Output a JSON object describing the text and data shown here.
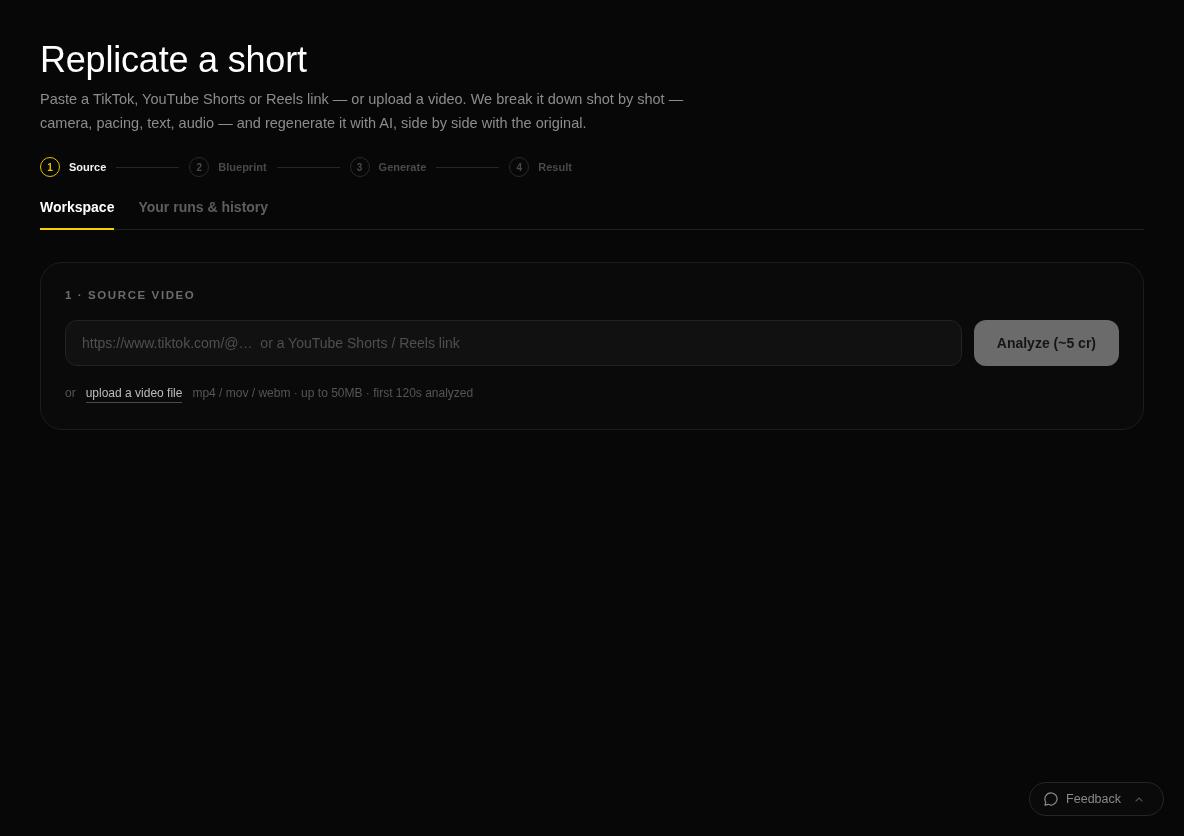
{
  "header": {
    "title": "Replicate a short",
    "subtitle": "Paste a TikTok, YouTube Shorts or Reels link — or upload a video. We break it down shot by shot — camera, pacing, text, audio — and regenerate it with AI, side by side with the original."
  },
  "steps": [
    {
      "number": "1",
      "label": "Source",
      "active": true
    },
    {
      "number": "2",
      "label": "Blueprint",
      "active": false
    },
    {
      "number": "3",
      "label": "Generate",
      "active": false
    },
    {
      "number": "4",
      "label": "Result",
      "active": false
    }
  ],
  "tabs": [
    {
      "label": "Workspace",
      "selected": true
    },
    {
      "label": "Your runs & history",
      "selected": false
    }
  ],
  "source_card": {
    "heading": "1 · SOURCE VIDEO",
    "url_field": {
      "placeholder": "https://www.tiktok.com/@…  or a YouTube Shorts / Reels link"
    },
    "analyze_button": {
      "label": "Analyze (~5 cr)",
      "disabled": true
    },
    "upload_row": {
      "prefix": "or",
      "link": "upload a video file",
      "hint": "mp4 / mov / webm · up to 50MB · first 120s analyzed"
    }
  },
  "feedback_button": {
    "label": "Feedback"
  }
}
